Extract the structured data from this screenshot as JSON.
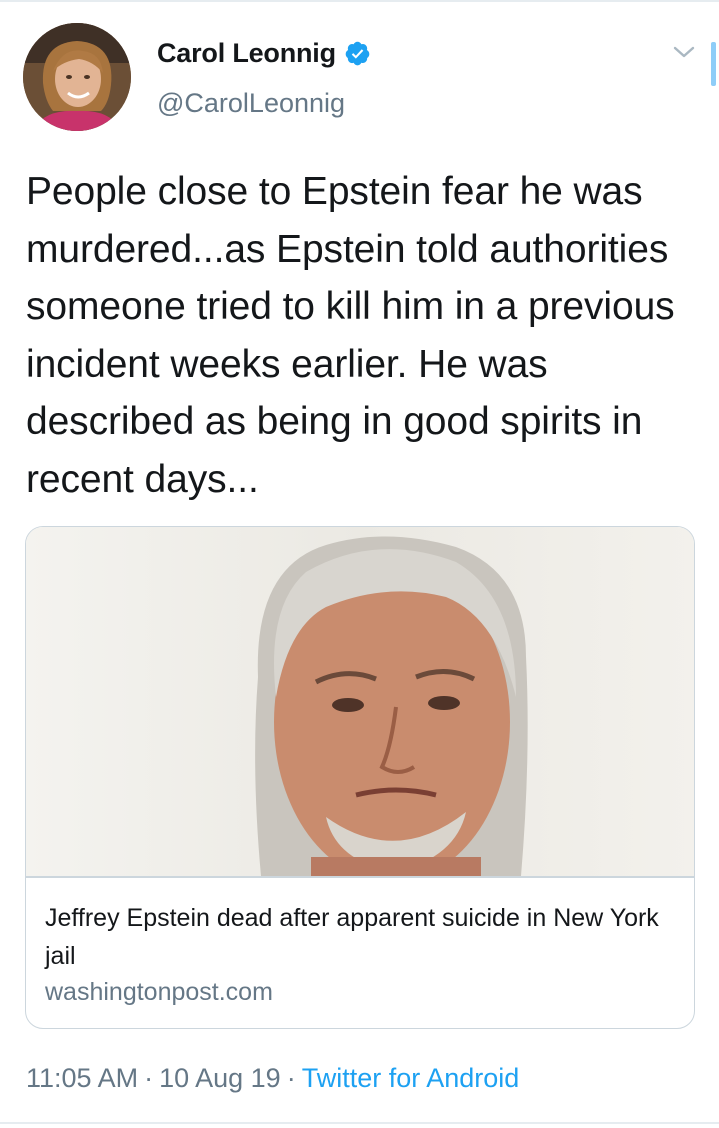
{
  "tweet": {
    "author": {
      "name": "Carol Leonnig",
      "handle": "@CarolLeonnig",
      "verified": true,
      "avatar_icon": "profile-photo"
    },
    "text": "People close to Epstein fear he was murdered...as Epstein told authorities someone tried to kill him in a previous incident weeks earlier. He was described as being in good spirits in recent days...",
    "card": {
      "image_icon": "news-photo",
      "title": "Jeffrey Epstein dead after apparent suicide in New York jail",
      "domain": "washingtonpost.com"
    },
    "meta": {
      "time": "11:05 AM",
      "date": "10 Aug 19",
      "separator": "·",
      "source": "Twitter for Android"
    }
  },
  "colors": {
    "text_primary": "#14171a",
    "text_secondary": "#657786",
    "accent": "#1da1f2",
    "border": "#ccd6dd"
  },
  "icons": [
    "verified-badge-icon",
    "chevron-down-icon"
  ]
}
